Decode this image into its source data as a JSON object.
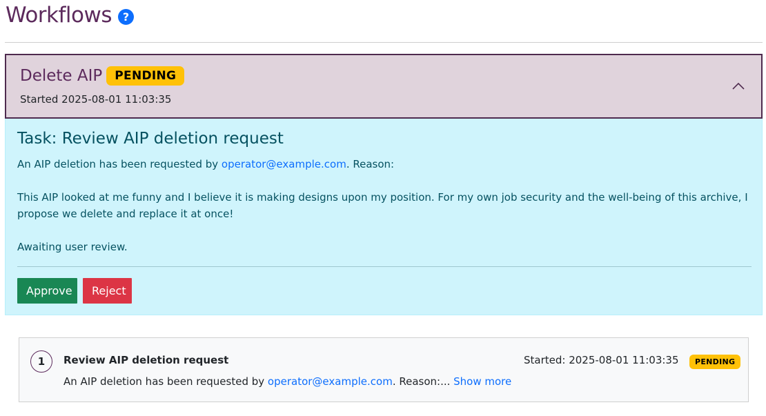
{
  "page": {
    "title": "Workflows",
    "help_icon": "question-circle-icon",
    "help_glyph": "?"
  },
  "workflow": {
    "title": "Delete AIP",
    "status": "PENDING",
    "started": "Started 2025-08-01 11:03:35",
    "toggle_icon": "chevron-up-icon",
    "colors": {
      "header_bg": "#e0d3dc",
      "header_border": "#4e2a4e",
      "badge": "#ffc107"
    }
  },
  "task": {
    "title": "Task: Review AIP deletion request",
    "request_prefix": "An AIP deletion has been requested by ",
    "requester": "operator@example.com",
    "request_suffix": ". Reason:",
    "reason": "This AIP looked at me funny and I believe it is making designs upon my position. For my own job security and the well-being of this archive, I propose we delete and replace it at once!",
    "status_text": "Awaiting user review.",
    "approve_label": "Approve",
    "reject_label": "Reject",
    "colors": {
      "panel_bg": "#cff4fc",
      "approve": "#198754",
      "reject": "#dc3545"
    }
  },
  "steps": [
    {
      "number": "1",
      "title": "Review AIP deletion request",
      "desc_prefix": "An AIP deletion has been requested by ",
      "requester": "operator@example.com",
      "desc_suffix": ". Reason:...",
      "show_more": "Show more",
      "started": "Started: 2025-08-01 11:03:35",
      "status": "PENDING"
    }
  ]
}
